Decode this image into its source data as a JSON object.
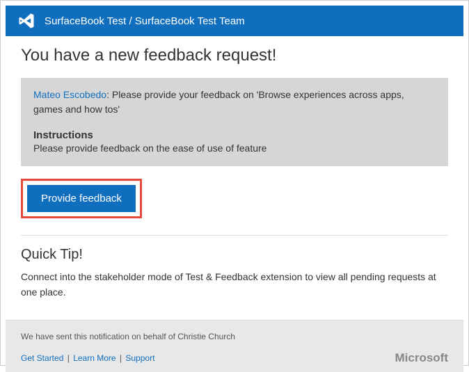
{
  "header": {
    "title": "SurfaceBook Test / SurfaceBook Test Team"
  },
  "page": {
    "heading": "You have a new feedback request!"
  },
  "request": {
    "requester_name": "Mateo Escobedo",
    "request_text": ": Please provide your feedback on 'Browse experiences across  apps, games and how tos'",
    "instructions_heading": "Instructions",
    "instructions_text": "Please provide feedback on the ease of use of feature"
  },
  "actions": {
    "provide_feedback_label": "Provide feedback"
  },
  "quicktip": {
    "heading": "Quick Tip!",
    "text": "Connect into the stakeholder mode of Test & Feedback extension to view all pending requests at one place."
  },
  "footer": {
    "sent_prefix": "We have sent this notification on behalf of  ",
    "sent_name": "Christie Church",
    "links": {
      "get_started": "Get Started",
      "learn_more": "Learn More",
      "support": "Support"
    },
    "brand": "Microsoft"
  }
}
